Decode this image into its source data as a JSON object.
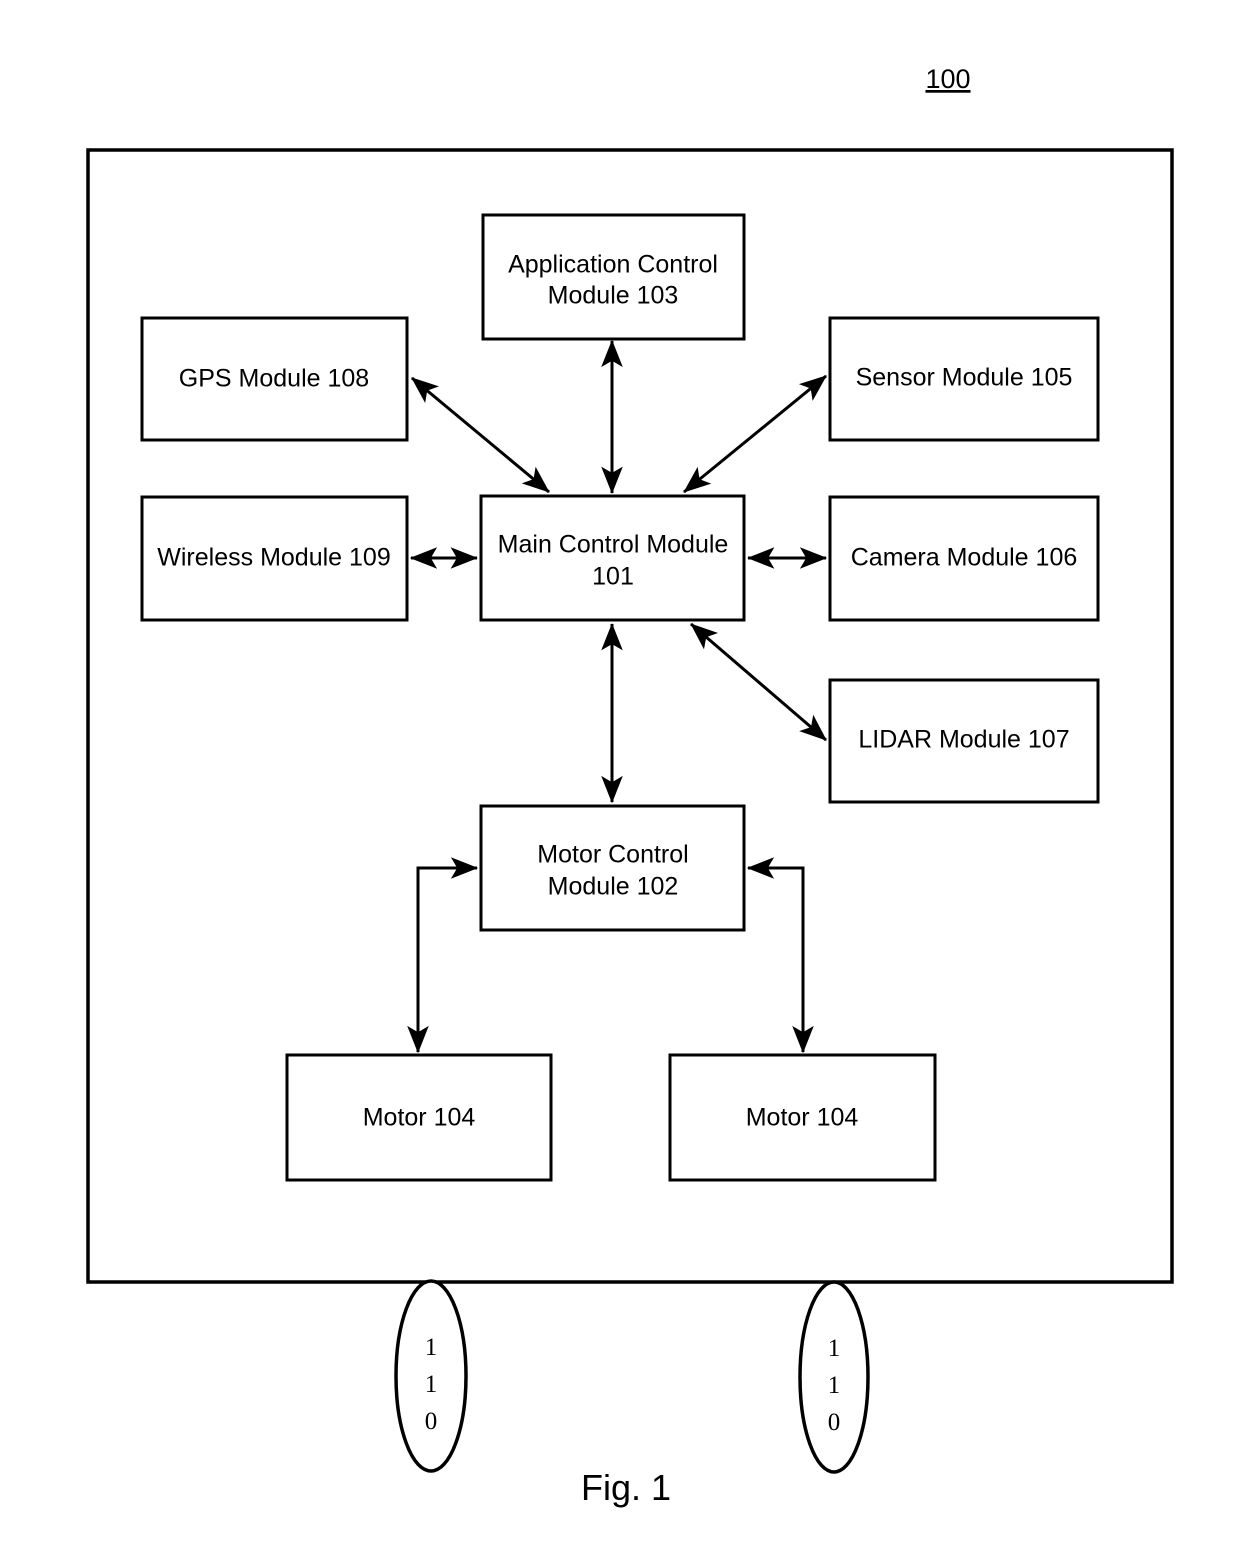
{
  "figure": {
    "system_number": "100",
    "caption": "Fig. 1"
  },
  "nodes": {
    "application_control": {
      "line1": "Application Control",
      "line2": "Module 103"
    },
    "gps": {
      "line1": "GPS Module 108",
      "line2": ""
    },
    "sensor": {
      "line1": "Sensor Module 105",
      "line2": ""
    },
    "wireless": {
      "line1": "Wireless Module 109",
      "line2": ""
    },
    "main_control": {
      "line1": "Main Control Module",
      "line2": "101"
    },
    "camera": {
      "line1": "Camera Module 106",
      "line2": ""
    },
    "lidar": {
      "line1": "LIDAR Module 107",
      "line2": ""
    },
    "motor_control": {
      "line1": "Motor Control",
      "line2": "Module 102"
    },
    "motor_left": {
      "line1": "Motor 104",
      "line2": ""
    },
    "motor_right": {
      "line1": "Motor 104",
      "line2": ""
    }
  },
  "wheels": {
    "left": {
      "d1": "1",
      "d2": "1",
      "d3": "0"
    },
    "right": {
      "d1": "1",
      "d2": "1",
      "d3": "0"
    }
  },
  "colors": {
    "stroke": "#000000",
    "fill": "#ffffff"
  }
}
